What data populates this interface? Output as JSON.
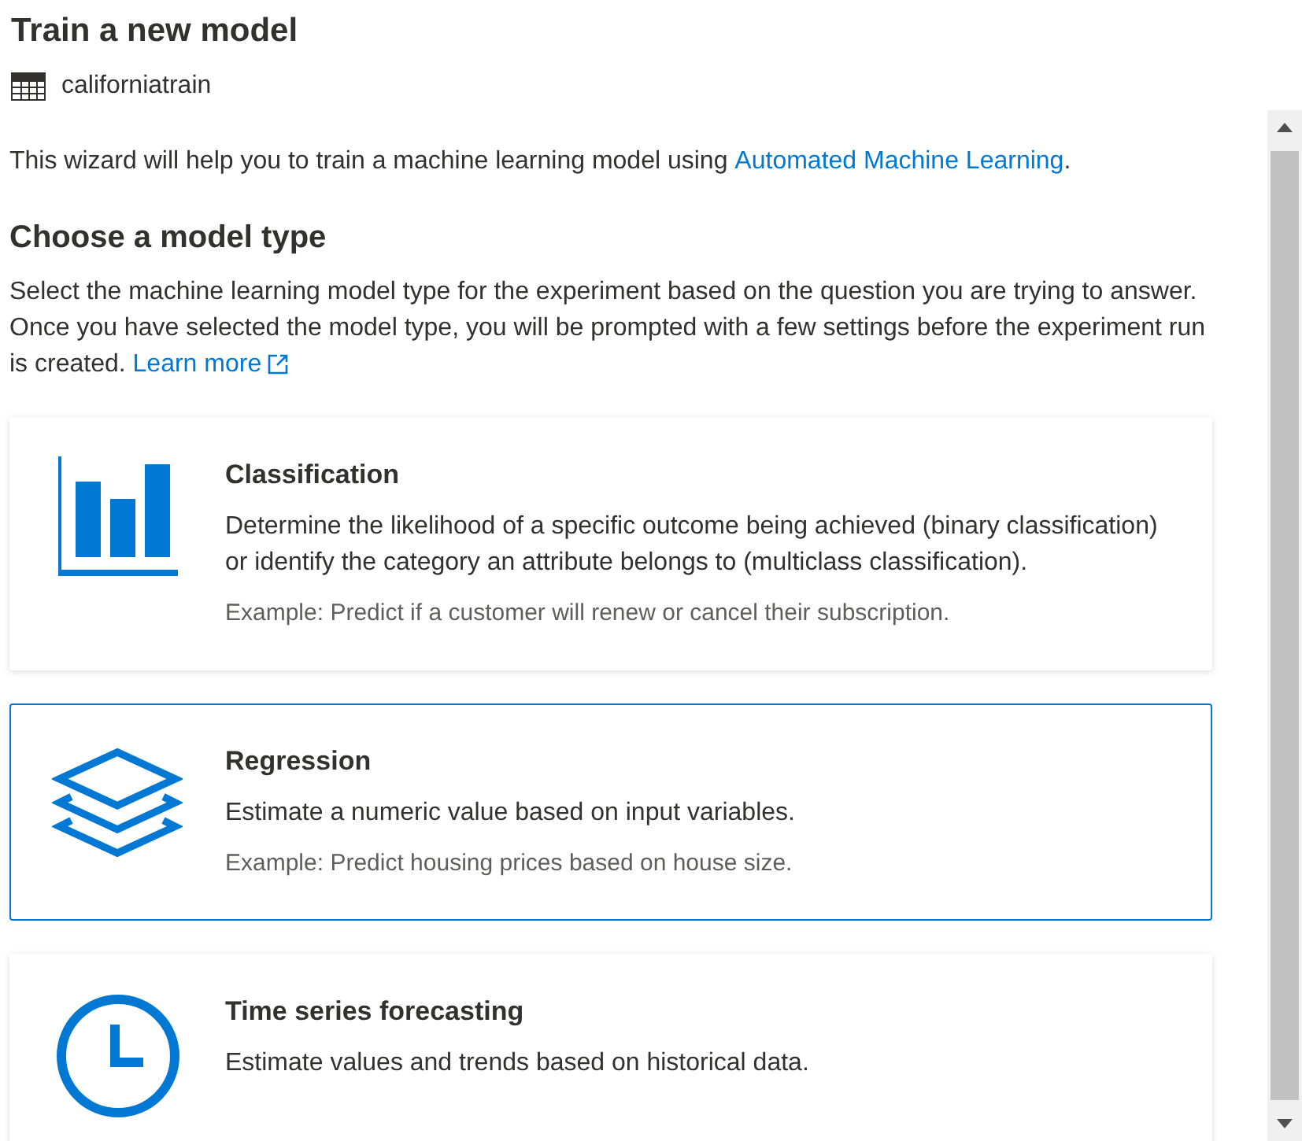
{
  "title": "Train a new model",
  "dataset": {
    "name": "californiatrain"
  },
  "intro": {
    "text": "This wizard will help you to train a machine learning model using ",
    "link": "Automated Machine Learning",
    "suffix": "."
  },
  "section": {
    "heading": "Choose a model type",
    "description": "Select the machine learning model type for the experiment based on the question you are trying to answer. Once you have selected the model type, you will be prompted with a few settings before the experiment run is created. ",
    "link": "Learn more"
  },
  "model_types": [
    {
      "kind": "bar-chart",
      "title": "Classification",
      "description": "Determine the likelihood of a specific outcome being achieved (binary classification) or identify the category an attribute belongs to (multiclass classification).",
      "example": "Example: Predict if a customer will renew or cancel their subscription.",
      "selected": false
    },
    {
      "kind": "layers",
      "title": "Regression",
      "description": "Estimate a numeric value based on input variables.",
      "example": "Example: Predict housing prices based on house size.",
      "selected": true
    },
    {
      "kind": "clock",
      "title": "Time series forecasting",
      "description": "Estimate values and trends based on historical data.",
      "selected": false
    }
  ]
}
